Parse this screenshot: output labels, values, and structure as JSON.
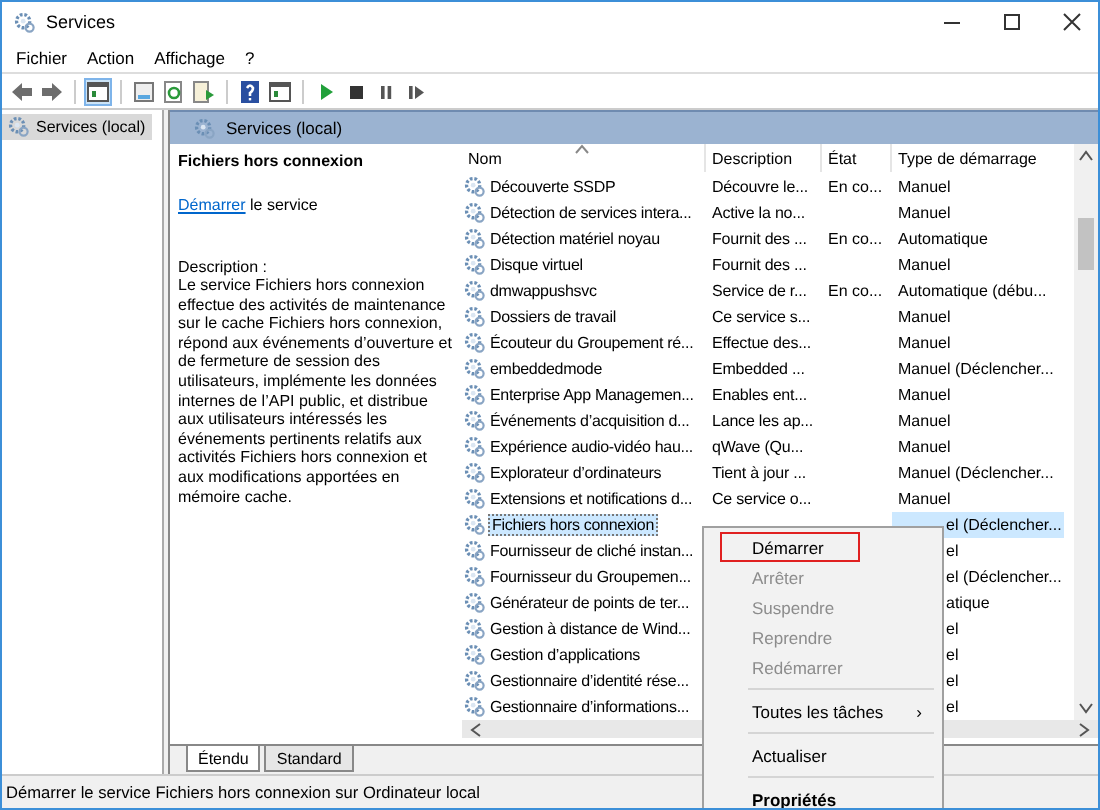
{
  "window": {
    "title": "Services"
  },
  "menu": [
    "Fichier",
    "Action",
    "Affichage",
    "?"
  ],
  "toolbar": [
    {
      "kind": "back"
    },
    {
      "kind": "forward"
    },
    {
      "kind": "sep"
    },
    {
      "kind": "console",
      "selected": true
    },
    {
      "kind": "sep"
    },
    {
      "kind": "export"
    },
    {
      "kind": "refresh"
    },
    {
      "kind": "properties"
    },
    {
      "kind": "sep"
    },
    {
      "kind": "help"
    },
    {
      "kind": "console2"
    },
    {
      "kind": "sep"
    },
    {
      "kind": "play"
    },
    {
      "kind": "stop"
    },
    {
      "kind": "pause"
    },
    {
      "kind": "resume"
    }
  ],
  "tree": [
    {
      "label": "Services (local)",
      "selected": true
    }
  ],
  "header": "Services (local)",
  "details": {
    "title": "Fichiers hors connexion",
    "link": "Démarrer",
    "link_rest": " le service",
    "description_label": "Description :",
    "description": "Le service Fichiers hors connexion effectue des activités de maintenance sur le cache Fichiers hors connexion, répond aux événements d’ouverture et de fermeture de session des utilisateurs, implémente les données internes de l’API public, et distribue aux utilisateurs intéressés les événements pertinents relatifs aux activités Fichiers hors connexion et aux modifications apportées en mémoire cache."
  },
  "table": {
    "columns": [
      "Nom",
      "Description",
      "État",
      "Type de démarrage"
    ],
    "rows": [
      {
        "name": "Découverte SSDP",
        "description": "Découvre le...",
        "state": "En co...",
        "startup": "Manuel",
        "selected": false
      },
      {
        "name": "Détection de services intera...",
        "description": "Active la no...",
        "startup": "Manuel",
        "selected": false
      },
      {
        "name": "Détection matériel noyau",
        "description": "Fournit des ...",
        "state": "En co...",
        "startup": "Automatique",
        "selected": false
      },
      {
        "name": "Disque virtuel",
        "description": "Fournit des ...",
        "startup": "Manuel",
        "selected": false
      },
      {
        "name": "dmwappushsvc",
        "description": "Service de r...",
        "state": "En co...",
        "startup": "Automatique (débu...",
        "selected": false
      },
      {
        "name": "Dossiers de travail",
        "description": "Ce service s...",
        "startup": "Manuel",
        "selected": false
      },
      {
        "name": "Écouteur du Groupement ré...",
        "description": "Effectue des...",
        "startup": "Manuel",
        "selected": false
      },
      {
        "name": "embeddedmode",
        "description": "Embedded ...",
        "startup": "Manuel (Déclencher...",
        "selected": false
      },
      {
        "name": "Enterprise App Managemen...",
        "description": "Enables ent...",
        "startup": "Manuel",
        "selected": false
      },
      {
        "name": "Événements d’acquisition d...",
        "description": "Lance les ap...",
        "startup": "Manuel",
        "selected": false
      },
      {
        "name": "Expérience audio-vidéo hau...",
        "description": "qWave (Qu...",
        "startup": "Manuel",
        "selected": false
      },
      {
        "name": "Explorateur d’ordinateurs",
        "description": "Tient à jour ...",
        "startup": "Manuel (Déclencher...",
        "selected": false
      },
      {
        "name": "Extensions et notifications d...",
        "description": "Ce service o...",
        "startup": "Manuel",
        "selected": false
      },
      {
        "name": "Fichiers hors connexion",
        "startup": "el (Déclencher...",
        "selected": true,
        "kind": "covered"
      },
      {
        "name": "Fournisseur de cliché instan...",
        "startup": "el",
        "selected": false,
        "kind": "covered"
      },
      {
        "name": "Fournisseur du Groupemen...",
        "startup": "el (Déclencher...",
        "selected": false,
        "kind": "covered"
      },
      {
        "name": "Générateur de points de ter...",
        "startup": "atique",
        "selected": false,
        "kind": "covered"
      },
      {
        "name": "Gestion à distance de Wind...",
        "startup": "el",
        "selected": false,
        "kind": "covered"
      },
      {
        "name": "Gestion d’applications",
        "startup": "el",
        "selected": false,
        "kind": "covered"
      },
      {
        "name": "Gestionnaire d’identité rése...",
        "startup": "el",
        "selected": false,
        "kind": "covered"
      },
      {
        "name": "Gestionnaire d’informations...",
        "startup": "el",
        "selected": false,
        "kind": "covered"
      }
    ]
  },
  "tabs": [
    {
      "label": "Étendu",
      "selected": true
    },
    {
      "label": "Standard",
      "selected": false
    }
  ],
  "context_menu": [
    {
      "kind": "item",
      "label": "Démarrer",
      "disabled": false,
      "focused": true
    },
    {
      "kind": "item",
      "label": "Arrêter",
      "disabled": true,
      "focused": false
    },
    {
      "kind": "item",
      "label": "Suspendre",
      "disabled": true,
      "focused": false
    },
    {
      "kind": "item",
      "label": "Reprendre",
      "disabled": true,
      "focused": false
    },
    {
      "kind": "item",
      "label": "Redémarrer",
      "disabled": true,
      "focused": false
    },
    {
      "kind": "sep"
    },
    {
      "kind": "submenu",
      "label": "Toutes les tâches",
      "arrow": "›",
      "disabled": false,
      "focused": false
    },
    {
      "kind": "sep"
    },
    {
      "kind": "item",
      "label": "Actualiser",
      "disabled": false,
      "focused": false
    },
    {
      "kind": "sep"
    },
    {
      "kind": "default",
      "label": "Propriétés",
      "disabled": false,
      "focused": false
    }
  ],
  "status_bar": "Démarrer le service Fichiers hors connexion sur Ordinateur local"
}
